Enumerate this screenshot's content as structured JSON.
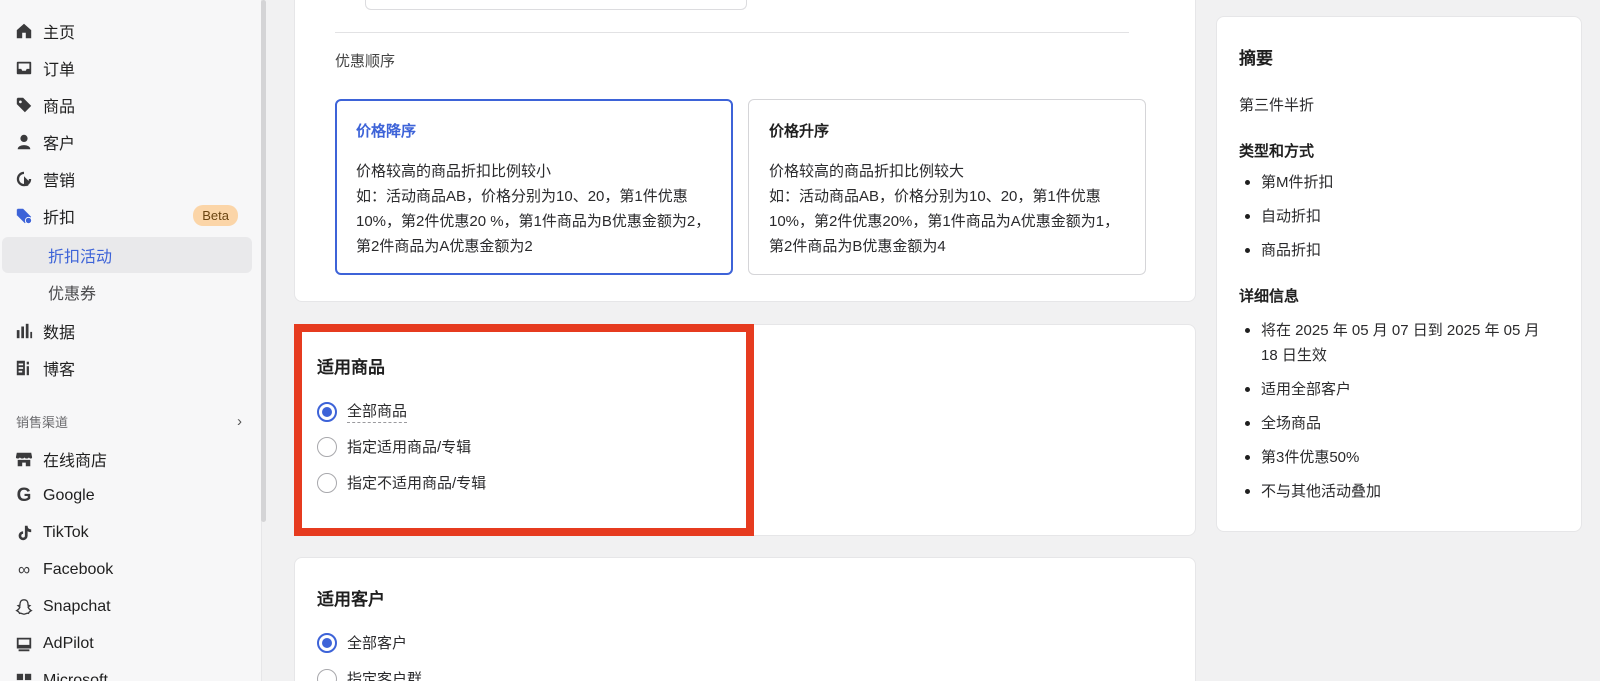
{
  "sidebar": {
    "items": [
      {
        "label": "主页",
        "icon": "home-icon"
      },
      {
        "label": "订单",
        "icon": "inbox-icon"
      },
      {
        "label": "商品",
        "icon": "tag-icon"
      },
      {
        "label": "客户",
        "icon": "person-icon"
      },
      {
        "label": "营销",
        "icon": "target-icon"
      },
      {
        "label": "折扣",
        "icon": "discount-tag-icon",
        "badge": "Beta"
      }
    ],
    "sub_items": [
      {
        "label": "折扣活动",
        "active": true
      },
      {
        "label": "优惠券",
        "active": false
      }
    ],
    "items2": [
      {
        "label": "数据",
        "icon": "bar-chart-icon"
      },
      {
        "label": "博客",
        "icon": "blog-icon"
      }
    ],
    "channels_label": "销售渠道",
    "channels": [
      {
        "label": "在线商店",
        "icon": "store-icon"
      },
      {
        "label": "Google",
        "icon": "google-icon"
      },
      {
        "label": "TikTok",
        "icon": "tiktok-icon"
      },
      {
        "label": "Facebook",
        "icon": "meta-icon"
      },
      {
        "label": "Snapchat",
        "icon": "snapchat-icon"
      },
      {
        "label": "AdPilot",
        "icon": "ad-icon"
      },
      {
        "label": "Microsoft",
        "icon": "microsoft-icon"
      }
    ]
  },
  "order": {
    "label": "优惠顺序",
    "options": [
      {
        "title": "价格降序",
        "desc": "价格较高的商品折扣比例较小\n如：活动商品AB，价格分别为10、20，第1件优惠10%，第2件优惠20 %，第1件商品为B优惠金额为2，第2件商品为A优惠金额为2",
        "selected": true
      },
      {
        "title": "价格升序",
        "desc": "价格较高的商品折扣比例较大\n如：活动商品AB，价格分别为10、20，第1件优惠10%，第2件优惠20%，第1件商品为A优惠金额为1，第2件商品为B优惠金额为4",
        "selected": false
      }
    ]
  },
  "goods": {
    "title": "适用商品",
    "options": [
      {
        "label": "全部商品",
        "checked": true
      },
      {
        "label": "指定适用商品/专辑",
        "checked": false
      },
      {
        "label": "指定不适用商品/专辑",
        "checked": false
      }
    ]
  },
  "customers": {
    "title": "适用客户",
    "options": [
      {
        "label": "全部客户",
        "checked": true
      },
      {
        "label": "指定客户群",
        "checked": false
      }
    ]
  },
  "summary": {
    "title": "摘要",
    "name": "第三件半折",
    "type_heading": "类型和方式",
    "type_items": [
      "第M件折扣",
      "自动折扣",
      "商品折扣"
    ],
    "detail_heading": "详细信息",
    "detail_items": [
      "将在 2025 年 05 月 07 日到 2025 年 05 月 18 日生效",
      "适用全部客户",
      "全场商品",
      "第3件优惠50%",
      "不与其他活动叠加"
    ]
  },
  "colors": {
    "accent": "#3d63d8",
    "highlight": "#e63b1f",
    "badge_bg": "#fbd5a8"
  }
}
